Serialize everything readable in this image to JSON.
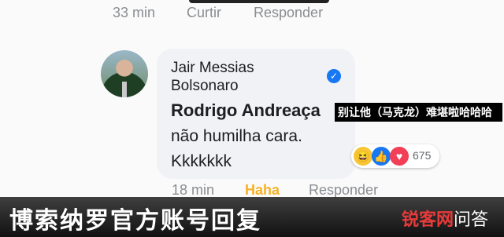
{
  "previous_comment": {
    "time": "33 min",
    "like": "Curtir",
    "reply": "Responder"
  },
  "comment": {
    "author": "Jair Messias Bolsonaro",
    "mention": "Rodrigo Andreaça",
    "text": "não humilha cara. Kkkkkkk",
    "time": "18 min",
    "reaction_label": "Haha",
    "reply": "Responder",
    "reaction_count": "675",
    "reactions": [
      "haha-icon",
      "like-icon",
      "love-icon"
    ]
  },
  "overlay_label": "别让他（马克龙）难堪啦哈哈哈",
  "caption": "博索纳罗官方账号回复",
  "watermark": {
    "brand": "锐客网",
    "suffix": "问答"
  },
  "colors": {
    "accent": "#1877f2",
    "haha": "#f7c634",
    "haha_label": "#f7b125",
    "love": "#f33e58"
  }
}
